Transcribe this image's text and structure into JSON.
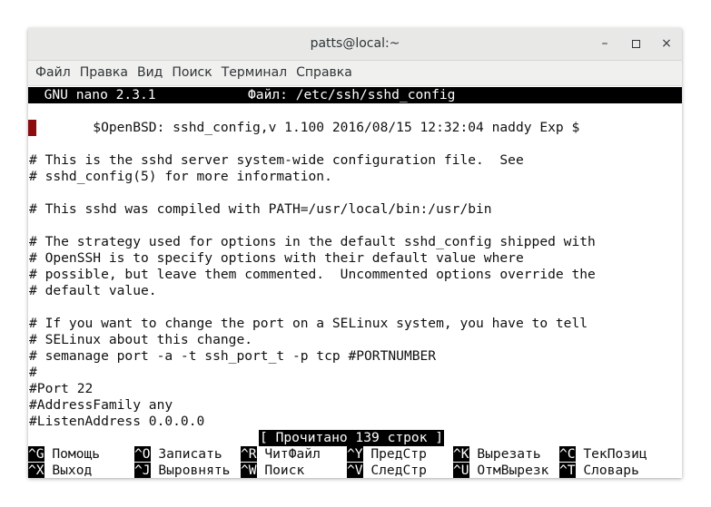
{
  "window": {
    "title": "patts@local:~",
    "controls": {
      "minimize": "–",
      "maximize": "□",
      "close": "×"
    }
  },
  "menu": [
    "Файл",
    "Правка",
    "Вид",
    "Поиск",
    "Терминал",
    "Справка"
  ],
  "nano": {
    "version": "  GNU nano 2.3.1",
    "file": "Файл: /etc/ssh/sshd_config"
  },
  "editor_lines": [
    "        $OpenBSD: sshd_config,v 1.100 2016/08/15 12:32:04 naddy Exp $",
    "",
    "# This is the sshd server system-wide configuration file.  See",
    "# sshd_config(5) for more information.",
    "",
    "# This sshd was compiled with PATH=/usr/local/bin:/usr/bin",
    "",
    "# The strategy used for options in the default sshd_config shipped with",
    "# OpenSSH is to specify options with their default value where",
    "# possible, but leave them commented.  Uncommented options override the",
    "# default value.",
    "",
    "# If you want to change the port on a SELinux system, you have to tell",
    "# SELinux about this change.",
    "# semanage port -a -t ssh_port_t -p tcp #PORTNUMBER",
    "#",
    "#Port 22",
    "#AddressFamily any",
    "#ListenAddress 0.0.0.0"
  ],
  "status": "[ Прочитано 139 строк ]",
  "shortcuts": [
    [
      {
        "key": "^G",
        "label": " Помощь"
      },
      {
        "key": "^O",
        "label": " Записать"
      },
      {
        "key": "^R",
        "label": " ЧитФайл"
      },
      {
        "key": "^Y",
        "label": " ПредСтр"
      },
      {
        "key": "^K",
        "label": " Вырезать"
      },
      {
        "key": "^C",
        "label": " ТекПозиц"
      }
    ],
    [
      {
        "key": "^X",
        "label": " Выход"
      },
      {
        "key": "^J",
        "label": " Выровнять"
      },
      {
        "key": "^W",
        "label": " Поиск"
      },
      {
        "key": "^V",
        "label": " СледСтр"
      },
      {
        "key": "^U",
        "label": " ОтмВырезк"
      },
      {
        "key": "^T",
        "label": " Словарь"
      }
    ]
  ]
}
